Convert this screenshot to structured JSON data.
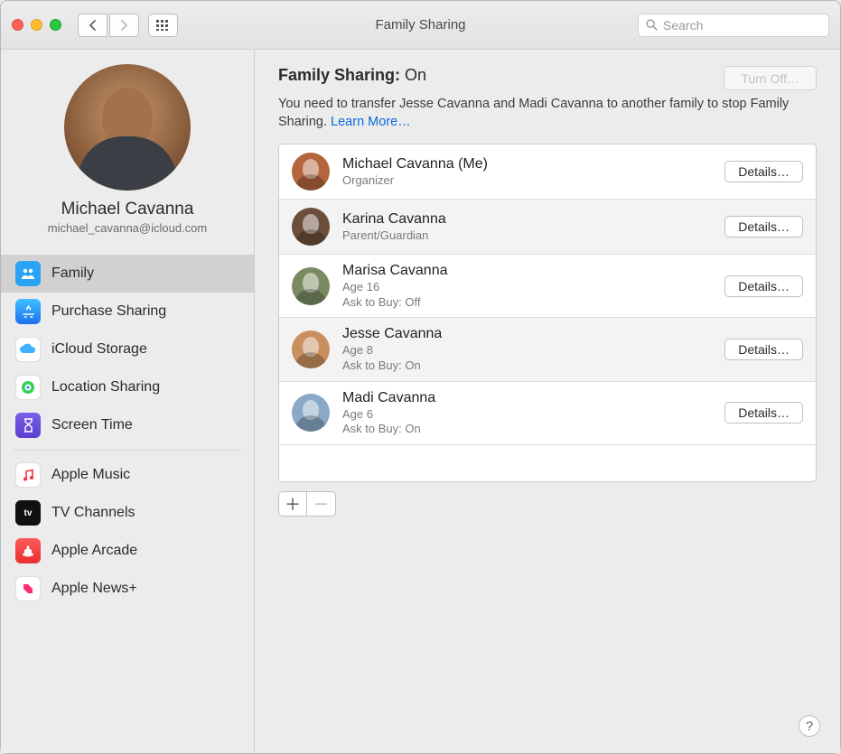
{
  "window": {
    "title": "Family Sharing"
  },
  "search": {
    "placeholder": "Search"
  },
  "profile": {
    "name": "Michael Cavanna",
    "email": "michael_cavanna@icloud.com"
  },
  "sidebar": {
    "group1": [
      {
        "label": "Family",
        "icon_bg": "#2aa3f5",
        "selected": true
      },
      {
        "label": "Purchase Sharing",
        "icon_bg": "#2a7af5",
        "selected": false
      },
      {
        "label": "iCloud Storage",
        "icon_bg": "#ffffff",
        "selected": false
      },
      {
        "label": "Location Sharing",
        "icon_bg": "#ffffff",
        "selected": false
      },
      {
        "label": "Screen Time",
        "icon_bg": "#6a4de0",
        "selected": false
      }
    ],
    "group2": [
      {
        "label": "Apple Music",
        "icon_bg": "#ffffff"
      },
      {
        "label": "TV Channels",
        "icon_bg": "#101010"
      },
      {
        "label": "Apple Arcade",
        "icon_bg": "#f23f3f"
      },
      {
        "label": "Apple News+",
        "icon_bg": "#ffffff"
      }
    ]
  },
  "main": {
    "heading_label": "Family Sharing:",
    "heading_status": "On",
    "turn_off_label": "Turn Off…",
    "message": "You need to transfer Jesse Cavanna and Madi Cavanna to another family to stop Family Sharing.",
    "learn_more": "Learn More…",
    "details_label": "Details…",
    "members": [
      {
        "name": "Michael Cavanna (Me)",
        "sub1": "Organizer",
        "sub2": "",
        "avatar_bg": "#b4653d"
      },
      {
        "name": "Karina Cavanna",
        "sub1": "Parent/Guardian",
        "sub2": "",
        "avatar_bg": "#6b4f3a"
      },
      {
        "name": "Marisa Cavanna",
        "sub1": "Age 16",
        "sub2": "Ask to Buy: Off",
        "avatar_bg": "#7a8a62"
      },
      {
        "name": "Jesse Cavanna",
        "sub1": "Age 8",
        "sub2": "Ask to Buy: On",
        "avatar_bg": "#c98f5e"
      },
      {
        "name": "Madi Cavanna",
        "sub1": "Age 6",
        "sub2": "Ask to Buy: On",
        "avatar_bg": "#8aa9c7"
      }
    ]
  },
  "icons": {
    "family": "👪",
    "purchase": "🅰",
    "icloud": "☁",
    "location": "◎",
    "screentime": "⏳",
    "music": "♫",
    "tv": "tv",
    "arcade": "✦",
    "news": "N"
  }
}
